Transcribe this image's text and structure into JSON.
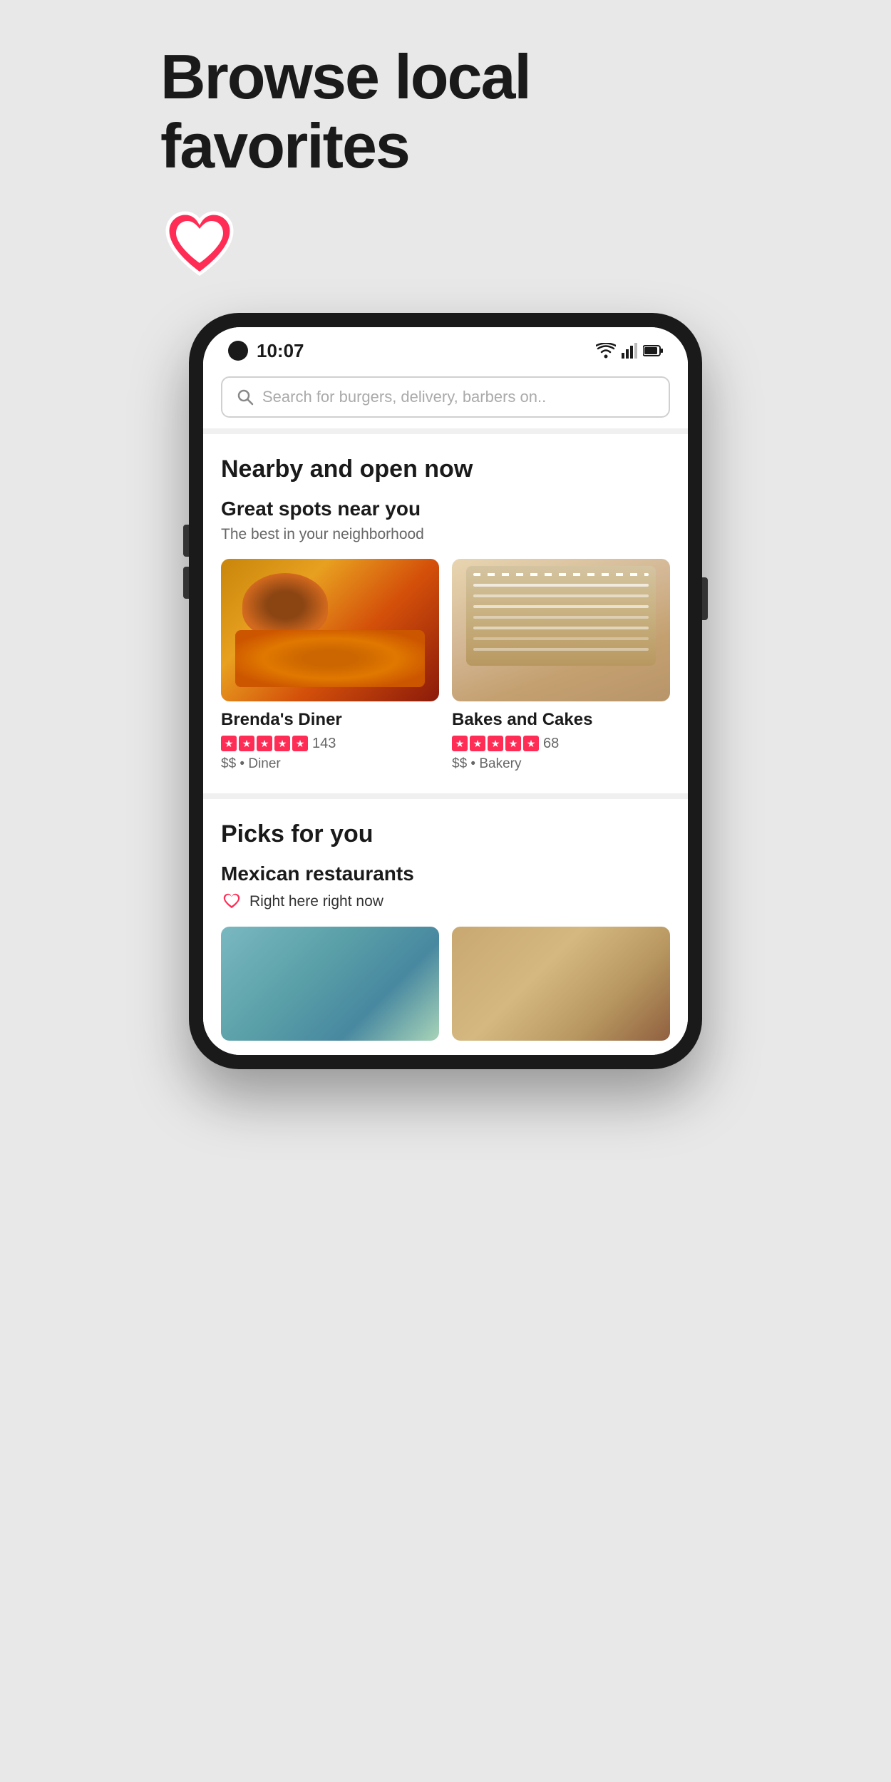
{
  "hero": {
    "title": "Browse local favorites",
    "logo_label": "Yelp heart logo"
  },
  "phone": {
    "status_bar": {
      "time": "10:07",
      "wifi_icon": "wifi-icon",
      "signal_icon": "signal-icon",
      "battery_icon": "battery-icon"
    },
    "search": {
      "placeholder": "Search for burgers, delivery, barbers on.."
    },
    "nearby_section": {
      "title": "Nearby and open now",
      "subsection_title": "Great spots near you",
      "subsection_subtitle": "The best in your neighborhood",
      "restaurants": [
        {
          "name": "Brenda's Diner",
          "rating": 5,
          "review_count": "143",
          "price": "$$",
          "category": "Diner"
        },
        {
          "name": "Bakes and Cakes",
          "rating": 5,
          "review_count": "68",
          "price": "$$",
          "category": "Bakery"
        }
      ]
    },
    "picks_section": {
      "title": "Picks for you",
      "subsection_title": "Mexican restaurants",
      "subsection_subtitle": "Right here right now"
    }
  }
}
